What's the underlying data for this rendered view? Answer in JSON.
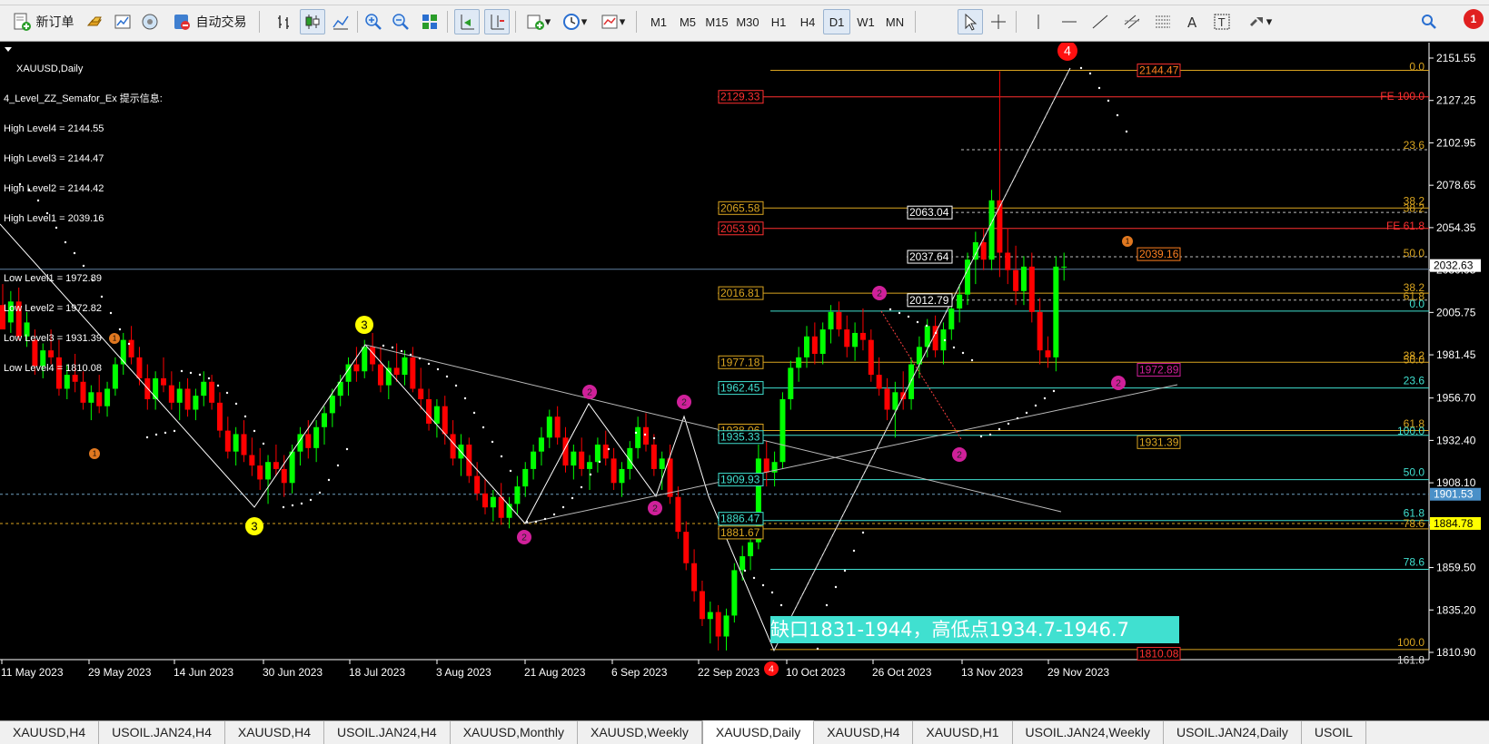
{
  "toolbar": {
    "new_order_label": "新订单",
    "auto_trade_label": "自动交易",
    "timeframes": [
      "M1",
      "M5",
      "M15",
      "M30",
      "H1",
      "H4",
      "D1",
      "W1",
      "MN"
    ],
    "selected_timeframe": "D1",
    "notification_count": "1"
  },
  "chart": {
    "symbol_title": "XAUUSD,Daily",
    "indicator_title": "4_Level_ZZ_Semafor_Ex 提示信息:",
    "info_lines": [
      "High Level4 = 2144.55",
      "High Level3 = 2144.47",
      "High Level2 = 2144.42",
      "High Level1 = 2039.16",
      "",
      "Low Level1 = 1972.89",
      "Low Level2 = 1972.82",
      "Low Level3 = 1931.39",
      "Low Level4 = 1810.08"
    ],
    "annotation": "缺口1831-1944，高低点1934.7-1946.7",
    "current_price": "2032.63",
    "price_tag_cyan": "1901.53",
    "price_tag_yellow": "1884.78",
    "price_axis": [
      "2151.55",
      "2127.25",
      "2102.95",
      "2078.65",
      "2054.35",
      "2030.05",
      "2005.75",
      "1981.45",
      "1956.70",
      "1932.40",
      "1908.10",
      "1883.80",
      "1859.50",
      "1835.20",
      "1810.90"
    ],
    "date_axis": [
      "11 May 2023",
      "29 May 2023",
      "14 Jun 2023",
      "30 Jun 2023",
      "18 Jul 2023",
      "3 Aug 2023",
      "21 Aug 2023",
      "6 Sep 2023",
      "22 Sep 2023",
      "10 Oct 2023",
      "26 Oct 2023",
      "13 Nov 2023",
      "29 Nov 2023"
    ],
    "level_boxes": {
      "red_2129": "2129.33",
      "red_2053": "2053.90",
      "yellow_2065": "2065.58",
      "yellow_2016": "2016.81",
      "yellow_1977": "1977.18",
      "teal_1962": "1962.45",
      "yellow_1938": "1938.06",
      "teal_1935": "1935.33",
      "teal_1909": "1909.93",
      "teal_1886": "1886.47",
      "yellow_1881": "1881.67",
      "white_2063": "2063.04",
      "white_2037": "2037.64",
      "white_2012": "2012.79",
      "right_2144": "2144.47",
      "right_2039": "2039.16",
      "right_1972": "1972.89",
      "right_1931": "1931.39",
      "right_1810": "1810.08"
    },
    "fib_labels": {
      "f0": "0.0",
      "fe100": "FE 100.0",
      "f236a": "23.6",
      "f382a": "38.2",
      "f382b": "38.2",
      "fe618": "FE 61.8",
      "f500a": "50.0",
      "f382c": "38.2",
      "f618a": "61.8",
      "f00b": "0.0",
      "f382d": "38.2",
      "f500b": "50.0",
      "f236b": "23.6",
      "f618b": "61.8",
      "f1000a": "100.0",
      "f500c": "50.0",
      "f618c": "61.8",
      "f786a": "78.6",
      "f786b": "78.6",
      "f1000b": "100.0",
      "f1618": "161.8"
    },
    "semafor_labels": {
      "one": "1",
      "two": "2",
      "three": "3",
      "four": "4"
    }
  },
  "tabs": [
    "XAUUSD,H4",
    "USOIL.JAN24,H4",
    "XAUUSD,H4",
    "USOIL.JAN24,H4",
    "XAUUSD,Monthly",
    "XAUUSD,Weekly",
    "XAUUSD,Daily",
    "XAUUSD,H4",
    "XAUUSD,H1",
    "USOIL.JAN24,Weekly",
    "USOIL.JAN24,Daily",
    "USOIL"
  ],
  "active_tab_index": 6,
  "colors": {
    "bull": "#00ff00",
    "bear": "#ff0000",
    "fib_yellow": "#daa520",
    "fib_teal": "#40e0d0",
    "fe_red": "#ff0000",
    "annotation_bg": "#40e0d0"
  }
}
